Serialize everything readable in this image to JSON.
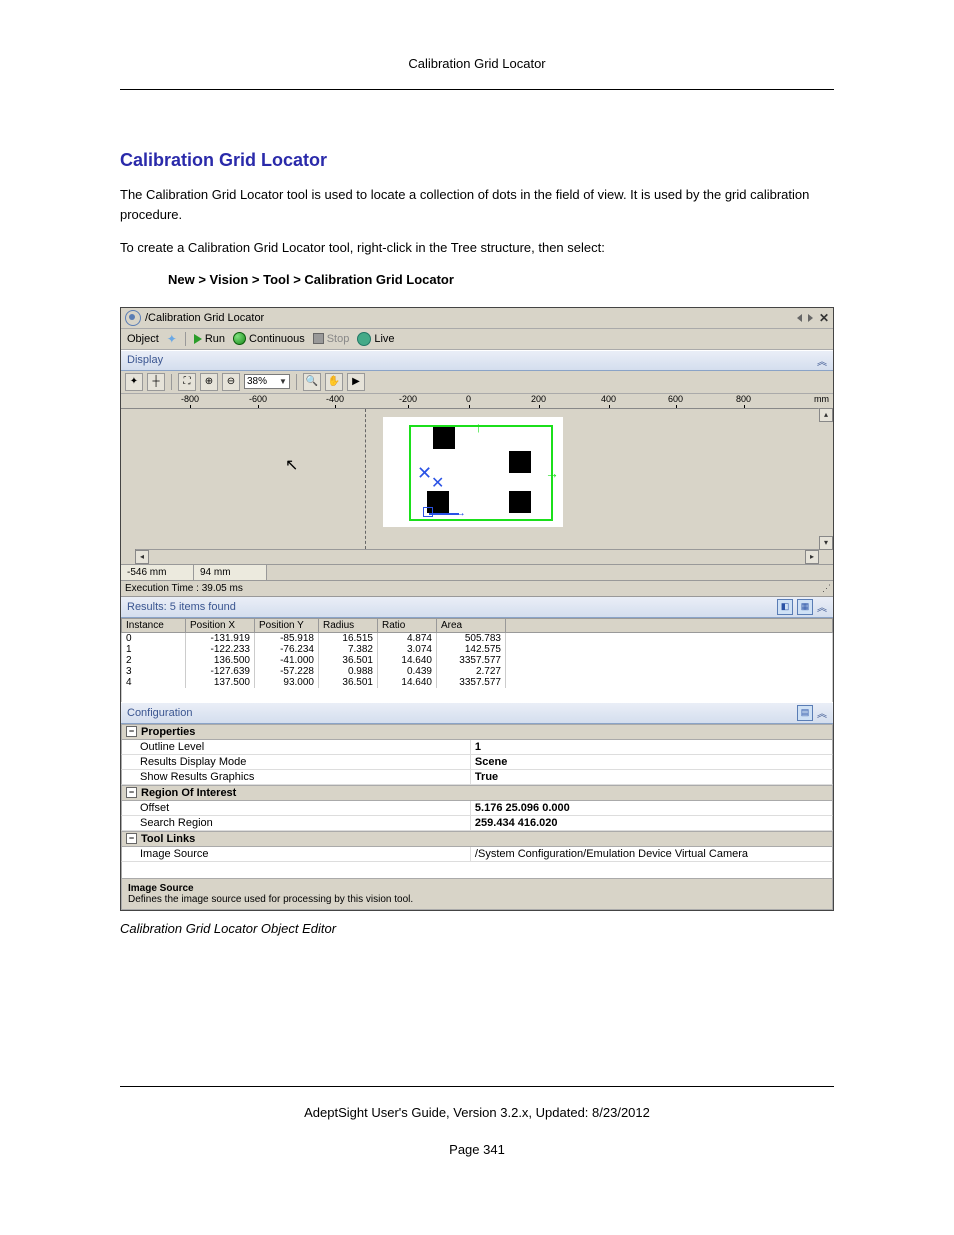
{
  "header": {
    "title": "Calibration Grid Locator"
  },
  "section": {
    "title": "Calibration Grid Locator",
    "para1": "The Calibration Grid Locator tool is used to locate a collection of dots in the field of view. It is used by the grid calibration procedure.",
    "para2": "To create a Calibration Grid Locator tool, right-click in the Tree structure, then select:",
    "menu_path": "New > Vision > Tool > Calibration Grid Locator"
  },
  "window": {
    "title": "/Calibration Grid Locator",
    "toolbar": {
      "object": "Object",
      "run": "Run",
      "continuous": "Continuous",
      "stop": "Stop",
      "live": "Live"
    },
    "display": {
      "label": "Display",
      "zoom": "38%",
      "ruler_unit": "mm",
      "ticks": [
        "-800",
        "-600",
        "-400",
        "-200",
        "0",
        "200",
        "400",
        "600",
        "800"
      ]
    },
    "status": {
      "x": "-546 mm",
      "y": "94 mm"
    },
    "exec": "Execution Time : 39.05 ms",
    "results": {
      "label": "Results: 5 items found",
      "cols": [
        "Instance",
        "Position X",
        "Position Y",
        "Radius",
        "Ratio",
        "Area"
      ],
      "rows": [
        [
          "0",
          "-131.919",
          "-85.918",
          "16.515",
          "4.874",
          "505.783"
        ],
        [
          "1",
          "-122.233",
          "-76.234",
          "7.382",
          "3.074",
          "142.575"
        ],
        [
          "2",
          "136.500",
          "-41.000",
          "36.501",
          "14.640",
          "3357.577"
        ],
        [
          "3",
          "-127.639",
          "-57.228",
          "0.988",
          "0.439",
          "2.727"
        ],
        [
          "4",
          "137.500",
          "93.000",
          "36.501",
          "14.640",
          "3357.577"
        ]
      ]
    },
    "config": {
      "label": "Configuration",
      "cats": {
        "properties": {
          "title": "Properties",
          "rows": [
            {
              "k": "Outline Level",
              "v": "1",
              "bold": true
            },
            {
              "k": "Results Display Mode",
              "v": "Scene",
              "bold": true
            },
            {
              "k": "Show Results Graphics",
              "v": "True",
              "bold": true
            }
          ]
        },
        "roi": {
          "title": "Region Of Interest",
          "rows": [
            {
              "k": "Offset",
              "v": "5.176 25.096 0.000",
              "bold": true
            },
            {
              "k": "Search Region",
              "v": "259.434 416.020",
              "bold": true
            }
          ]
        },
        "links": {
          "title": "Tool Links",
          "rows": [
            {
              "k": "Image Source",
              "v": "/System Configuration/Emulation Device Virtual Camera",
              "bold": false
            }
          ]
        }
      },
      "help": {
        "title": "Image Source",
        "desc": "Defines the image source used for processing by this vision tool."
      }
    }
  },
  "caption": "Calibration Grid Locator Object Editor",
  "footer": {
    "guide": "AdeptSight User's Guide,  Version 3.2.x, Updated: 8/23/2012",
    "page": "Page 341"
  }
}
